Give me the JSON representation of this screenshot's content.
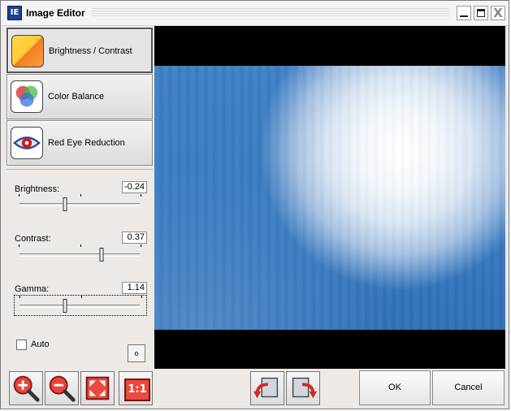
{
  "window": {
    "title": "Image Editor",
    "icon_text": "IE"
  },
  "tools": [
    {
      "label": "Brightness / Contrast",
      "icon": "brightness-contrast-icon",
      "active": true
    },
    {
      "label": "Color Balance",
      "icon": "color-balance-icon",
      "active": false
    },
    {
      "label": "Red Eye Reduction",
      "icon": "red-eye-icon",
      "active": false
    }
  ],
  "sliders": {
    "brightness": {
      "label": "Brightness:",
      "value": "-0.24",
      "level": 0.38
    },
    "contrast": {
      "label": "Contrast:",
      "value": "0.37",
      "level": 0.68
    },
    "gamma": {
      "label": "Gamma:",
      "value": "1.14",
      "level": 0.38
    }
  },
  "auto": {
    "label": "Auto",
    "checked": false
  },
  "small_button_label": "o",
  "bottom": {
    "zoom_in": "zoom-in-icon",
    "zoom_out": "zoom-out-icon",
    "fit": "fit-to-window-icon",
    "actual_size": "1:1",
    "rotate_left": "rotate-left-icon",
    "rotate_right": "rotate-right-icon",
    "ok_label": "OK",
    "cancel_label": "Cancel"
  },
  "colors": {
    "sky_blue": "#3679c0",
    "accent_red": "#cc1a1a"
  }
}
